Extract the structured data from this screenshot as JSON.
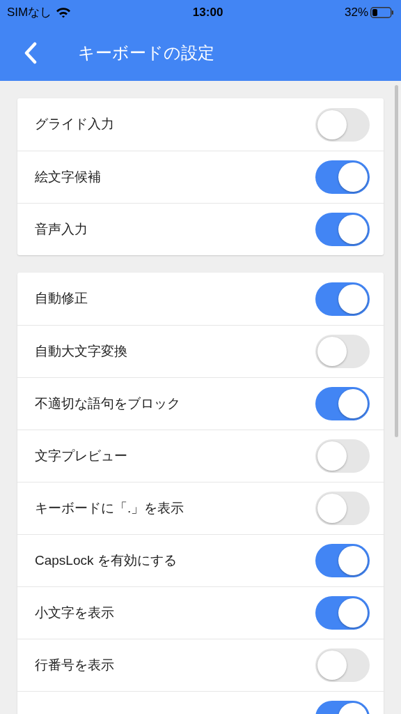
{
  "status_bar": {
    "carrier": "SIMなし",
    "time": "13:00",
    "battery": "32%"
  },
  "header": {
    "title": "キーボードの設定"
  },
  "sections": [
    {
      "items": [
        {
          "label": "グライド入力",
          "on": false
        },
        {
          "label": "絵文字候補",
          "on": true
        },
        {
          "label": "音声入力",
          "on": true
        }
      ]
    },
    {
      "items": [
        {
          "label": "自動修正",
          "on": true
        },
        {
          "label": "自動大文字変換",
          "on": false
        },
        {
          "label": "不適切な語句をブロック",
          "on": true
        },
        {
          "label": "文字プレビュー",
          "on": false
        },
        {
          "label": "キーボードに「.」を表示",
          "on": false
        },
        {
          "label": "CapsLock を有効にする",
          "on": true
        },
        {
          "label": "小文字を表示",
          "on": true
        },
        {
          "label": "行番号を表示",
          "on": false
        },
        {
          "on": true
        }
      ]
    }
  ]
}
